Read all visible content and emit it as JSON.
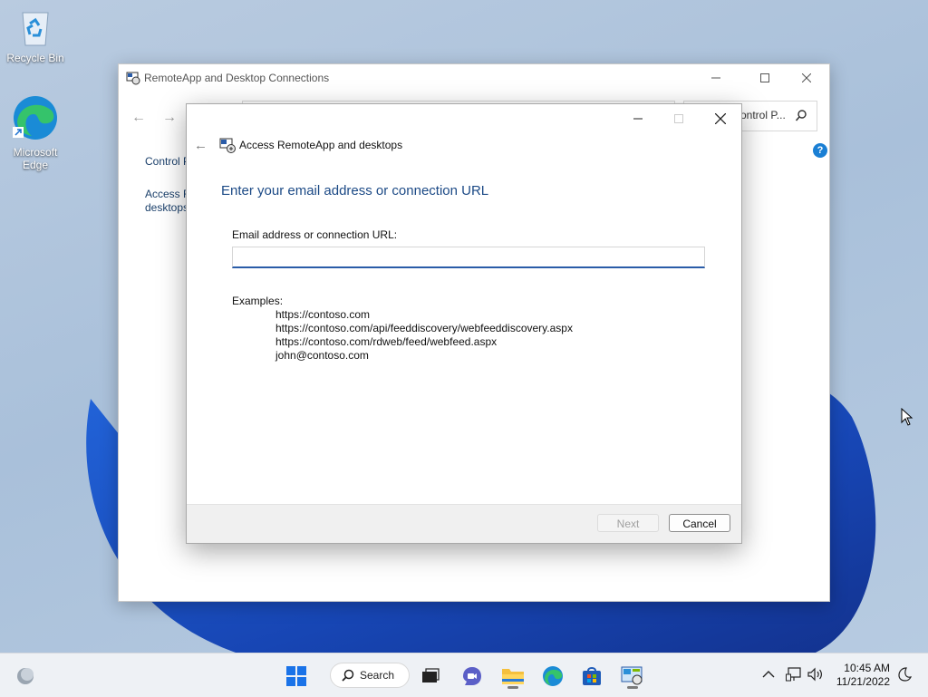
{
  "desktop": {
    "icons": [
      {
        "label": "Recycle Bin"
      },
      {
        "label_line1": "Microsoft",
        "label_line2": "Edge"
      }
    ]
  },
  "back_window": {
    "title": "RemoteApp and Desktop Connections",
    "search_placeholder": "ontrol P...",
    "sidebar": {
      "link1": "Control P",
      "link2_line1": "Access R",
      "link2_line2": "desktops"
    },
    "help_label": "?"
  },
  "dialog": {
    "title": "Access RemoteApp and desktops",
    "heading": "Enter your email address or connection URL",
    "field_label": "Email address or connection URL:",
    "field_value": "",
    "examples_label": "Examples:",
    "examples": [
      "https://contoso.com",
      "https://contoso.com/api/feeddiscovery/webfeeddiscovery.aspx",
      "https://contoso.com/rdweb/feed/webfeed.aspx",
      "john@contoso.com"
    ],
    "buttons": {
      "next": "Next",
      "cancel": "Cancel"
    }
  },
  "taskbar": {
    "search_label": "Search",
    "clock": {
      "time": "10:45 AM",
      "date": "11/21/2022"
    }
  },
  "colors": {
    "accent": "#2a5ca8",
    "heading": "#1c4a86",
    "help": "#1a7fd4"
  }
}
